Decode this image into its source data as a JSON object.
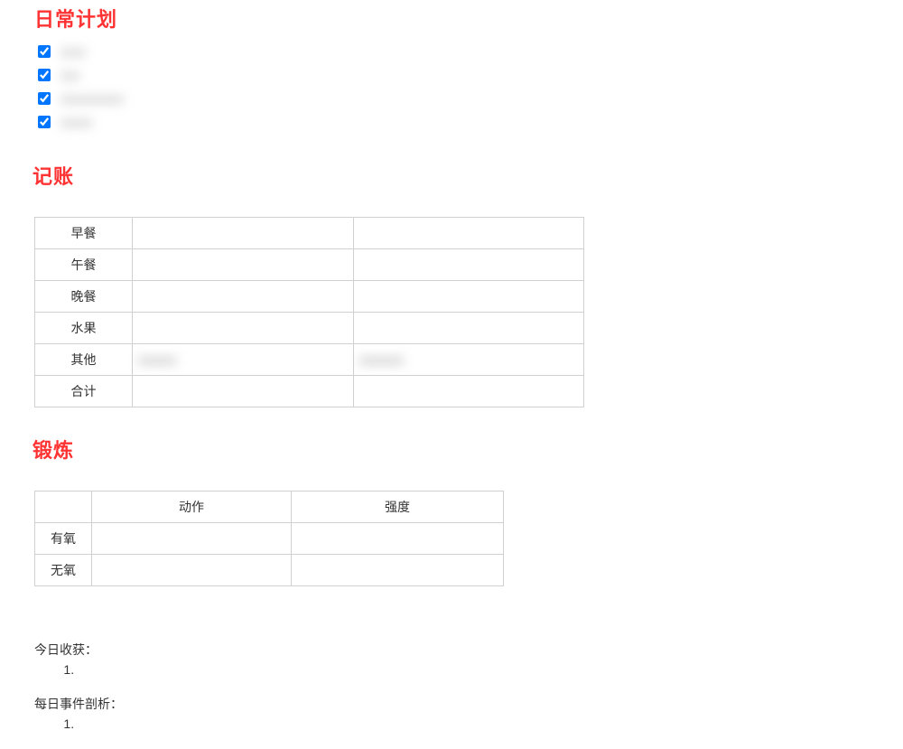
{
  "sections": {
    "plan": {
      "heading": "日常计划",
      "items": [
        {
          "checked": true,
          "label": ""
        },
        {
          "checked": true,
          "label": ""
        },
        {
          "checked": true,
          "label": ""
        },
        {
          "checked": true,
          "label": ""
        }
      ]
    },
    "bookkeeping": {
      "heading": "记账",
      "rows": [
        {
          "label": "早餐",
          "c2": "",
          "c3": ""
        },
        {
          "label": "午餐",
          "c2": "",
          "c3": ""
        },
        {
          "label": "晚餐",
          "c2": "",
          "c3": ""
        },
        {
          "label": "水果",
          "c2": "",
          "c3": ""
        },
        {
          "label": "其他",
          "c2": "",
          "c3": "",
          "blurred": true
        },
        {
          "label": "合计",
          "c2": "",
          "c3": ""
        }
      ]
    },
    "exercise": {
      "heading": "锻炼",
      "header": [
        "",
        "动作",
        "强度"
      ],
      "rows": [
        {
          "label": "有氧",
          "action": "",
          "intensity": ""
        },
        {
          "label": "无氧",
          "action": "",
          "intensity": ""
        }
      ]
    },
    "notes": {
      "harvest_title": "今日收获：",
      "analysis_title": "每日事件剖析："
    }
  }
}
